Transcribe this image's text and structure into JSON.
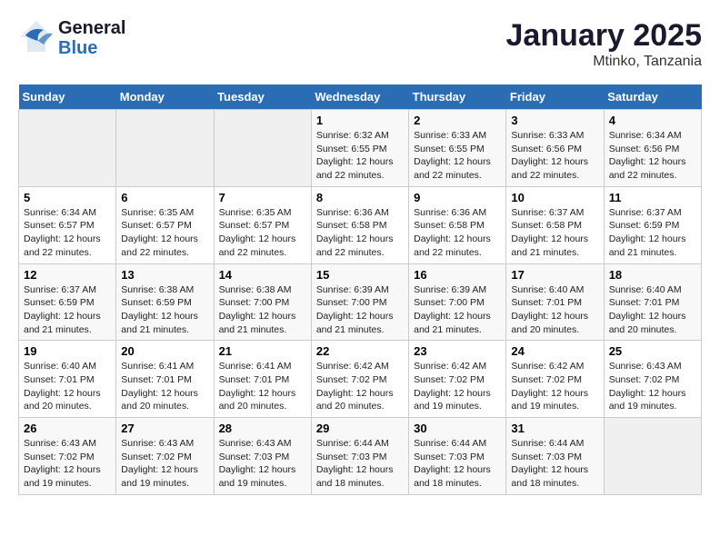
{
  "header": {
    "logo_line1": "General",
    "logo_line2": "Blue",
    "title": "January 2025",
    "subtitle": "Mtinko, Tanzania"
  },
  "days_of_week": [
    "Sunday",
    "Monday",
    "Tuesday",
    "Wednesday",
    "Thursday",
    "Friday",
    "Saturday"
  ],
  "weeks": [
    [
      {
        "day": "",
        "sunrise": "",
        "sunset": "",
        "daylight": ""
      },
      {
        "day": "",
        "sunrise": "",
        "sunset": "",
        "daylight": ""
      },
      {
        "day": "",
        "sunrise": "",
        "sunset": "",
        "daylight": ""
      },
      {
        "day": "1",
        "sunrise": "Sunrise: 6:32 AM",
        "sunset": "Sunset: 6:55 PM",
        "daylight": "Daylight: 12 hours and 22 minutes."
      },
      {
        "day": "2",
        "sunrise": "Sunrise: 6:33 AM",
        "sunset": "Sunset: 6:55 PM",
        "daylight": "Daylight: 12 hours and 22 minutes."
      },
      {
        "day": "3",
        "sunrise": "Sunrise: 6:33 AM",
        "sunset": "Sunset: 6:56 PM",
        "daylight": "Daylight: 12 hours and 22 minutes."
      },
      {
        "day": "4",
        "sunrise": "Sunrise: 6:34 AM",
        "sunset": "Sunset: 6:56 PM",
        "daylight": "Daylight: 12 hours and 22 minutes."
      }
    ],
    [
      {
        "day": "5",
        "sunrise": "Sunrise: 6:34 AM",
        "sunset": "Sunset: 6:57 PM",
        "daylight": "Daylight: 12 hours and 22 minutes."
      },
      {
        "day": "6",
        "sunrise": "Sunrise: 6:35 AM",
        "sunset": "Sunset: 6:57 PM",
        "daylight": "Daylight: 12 hours and 22 minutes."
      },
      {
        "day": "7",
        "sunrise": "Sunrise: 6:35 AM",
        "sunset": "Sunset: 6:57 PM",
        "daylight": "Daylight: 12 hours and 22 minutes."
      },
      {
        "day": "8",
        "sunrise": "Sunrise: 6:36 AM",
        "sunset": "Sunset: 6:58 PM",
        "daylight": "Daylight: 12 hours and 22 minutes."
      },
      {
        "day": "9",
        "sunrise": "Sunrise: 6:36 AM",
        "sunset": "Sunset: 6:58 PM",
        "daylight": "Daylight: 12 hours and 22 minutes."
      },
      {
        "day": "10",
        "sunrise": "Sunrise: 6:37 AM",
        "sunset": "Sunset: 6:58 PM",
        "daylight": "Daylight: 12 hours and 21 minutes."
      },
      {
        "day": "11",
        "sunrise": "Sunrise: 6:37 AM",
        "sunset": "Sunset: 6:59 PM",
        "daylight": "Daylight: 12 hours and 21 minutes."
      }
    ],
    [
      {
        "day": "12",
        "sunrise": "Sunrise: 6:37 AM",
        "sunset": "Sunset: 6:59 PM",
        "daylight": "Daylight: 12 hours and 21 minutes."
      },
      {
        "day": "13",
        "sunrise": "Sunrise: 6:38 AM",
        "sunset": "Sunset: 6:59 PM",
        "daylight": "Daylight: 12 hours and 21 minutes."
      },
      {
        "day": "14",
        "sunrise": "Sunrise: 6:38 AM",
        "sunset": "Sunset: 7:00 PM",
        "daylight": "Daylight: 12 hours and 21 minutes."
      },
      {
        "day": "15",
        "sunrise": "Sunrise: 6:39 AM",
        "sunset": "Sunset: 7:00 PM",
        "daylight": "Daylight: 12 hours and 21 minutes."
      },
      {
        "day": "16",
        "sunrise": "Sunrise: 6:39 AM",
        "sunset": "Sunset: 7:00 PM",
        "daylight": "Daylight: 12 hours and 21 minutes."
      },
      {
        "day": "17",
        "sunrise": "Sunrise: 6:40 AM",
        "sunset": "Sunset: 7:01 PM",
        "daylight": "Daylight: 12 hours and 20 minutes."
      },
      {
        "day": "18",
        "sunrise": "Sunrise: 6:40 AM",
        "sunset": "Sunset: 7:01 PM",
        "daylight": "Daylight: 12 hours and 20 minutes."
      }
    ],
    [
      {
        "day": "19",
        "sunrise": "Sunrise: 6:40 AM",
        "sunset": "Sunset: 7:01 PM",
        "daylight": "Daylight: 12 hours and 20 minutes."
      },
      {
        "day": "20",
        "sunrise": "Sunrise: 6:41 AM",
        "sunset": "Sunset: 7:01 PM",
        "daylight": "Daylight: 12 hours and 20 minutes."
      },
      {
        "day": "21",
        "sunrise": "Sunrise: 6:41 AM",
        "sunset": "Sunset: 7:01 PM",
        "daylight": "Daylight: 12 hours and 20 minutes."
      },
      {
        "day": "22",
        "sunrise": "Sunrise: 6:42 AM",
        "sunset": "Sunset: 7:02 PM",
        "daylight": "Daylight: 12 hours and 20 minutes."
      },
      {
        "day": "23",
        "sunrise": "Sunrise: 6:42 AM",
        "sunset": "Sunset: 7:02 PM",
        "daylight": "Daylight: 12 hours and 19 minutes."
      },
      {
        "day": "24",
        "sunrise": "Sunrise: 6:42 AM",
        "sunset": "Sunset: 7:02 PM",
        "daylight": "Daylight: 12 hours and 19 minutes."
      },
      {
        "day": "25",
        "sunrise": "Sunrise: 6:43 AM",
        "sunset": "Sunset: 7:02 PM",
        "daylight": "Daylight: 12 hours and 19 minutes."
      }
    ],
    [
      {
        "day": "26",
        "sunrise": "Sunrise: 6:43 AM",
        "sunset": "Sunset: 7:02 PM",
        "daylight": "Daylight: 12 hours and 19 minutes."
      },
      {
        "day": "27",
        "sunrise": "Sunrise: 6:43 AM",
        "sunset": "Sunset: 7:02 PM",
        "daylight": "Daylight: 12 hours and 19 minutes."
      },
      {
        "day": "28",
        "sunrise": "Sunrise: 6:43 AM",
        "sunset": "Sunset: 7:03 PM",
        "daylight": "Daylight: 12 hours and 19 minutes."
      },
      {
        "day": "29",
        "sunrise": "Sunrise: 6:44 AM",
        "sunset": "Sunset: 7:03 PM",
        "daylight": "Daylight: 12 hours and 18 minutes."
      },
      {
        "day": "30",
        "sunrise": "Sunrise: 6:44 AM",
        "sunset": "Sunset: 7:03 PM",
        "daylight": "Daylight: 12 hours and 18 minutes."
      },
      {
        "day": "31",
        "sunrise": "Sunrise: 6:44 AM",
        "sunset": "Sunset: 7:03 PM",
        "daylight": "Daylight: 12 hours and 18 minutes."
      },
      {
        "day": "",
        "sunrise": "",
        "sunset": "",
        "daylight": ""
      }
    ]
  ]
}
